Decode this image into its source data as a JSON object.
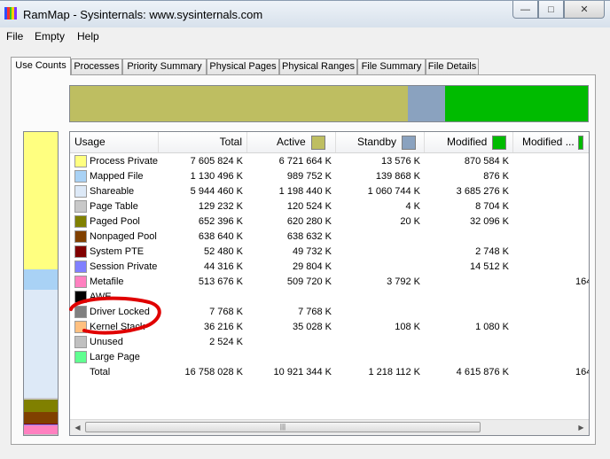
{
  "window": {
    "title": "RamMap - Sysinternals: www.sysinternals.com"
  },
  "caption": {
    "minimize": "—",
    "maximize": "□",
    "close": "✕"
  },
  "menu": [
    "File",
    "Empty",
    "Help"
  ],
  "tabs": [
    "Use Counts",
    "Processes",
    "Priority Summary",
    "Physical Pages",
    "Physical Ranges",
    "File Summary",
    "File Details"
  ],
  "active_tab": "Use Counts",
  "colors": {
    "active": "#bebe61",
    "standby": "#8aa2bf",
    "modified": "#00bb00",
    "modified_nowrite": "#00bb00",
    "process_private": "#ffff80",
    "mapped_file": "#a9d2f5",
    "shareable": "#dde9f7",
    "page_table": "#c8c8c8",
    "paged_pool": "#808000",
    "nonpaged_pool": "#804000",
    "system_pte": "#800000",
    "session_private": "#8080ff",
    "metafile": "#ff80c0",
    "awe": "#000000",
    "driver_locked": "#808080",
    "kernel_stack": "#ffc080",
    "unused": "#c0c0c0",
    "large_page": "#60ff90",
    "annotation": "#e00000"
  },
  "usage_bar": [
    {
      "name": "active",
      "fraction": 0.652
    },
    {
      "name": "standby",
      "fraction": 0.073
    },
    {
      "name": "modified",
      "fraction": 0.275
    }
  ],
  "sidebar_bar": [
    {
      "name": "process_private",
      "fraction": 0.454
    },
    {
      "name": "mapped_file",
      "fraction": 0.067
    },
    {
      "name": "shareable",
      "fraction": 0.355
    },
    {
      "name": "page_table",
      "fraction": 0.008
    },
    {
      "name": "paged_pool",
      "fraction": 0.039
    },
    {
      "name": "nonpaged_pool",
      "fraction": 0.038
    },
    {
      "name": "system_pte",
      "fraction": 0.003
    },
    {
      "name": "session_private",
      "fraction": 0.003
    },
    {
      "name": "metafile",
      "fraction": 0.031
    },
    {
      "name": "unused",
      "fraction": 0.002
    }
  ],
  "columns": [
    "Usage",
    "Total",
    "Active",
    "Standby",
    "Modified",
    "Modified ..."
  ],
  "rows": [
    {
      "name": "Process Private",
      "color": "process_private",
      "total": "7 605 824 K",
      "active": "6 721 664 K",
      "standby": "13 576 K",
      "modified": "870 584 K",
      "modified_nw": ""
    },
    {
      "name": "Mapped File",
      "color": "mapped_file",
      "total": "1 130 496 K",
      "active": "989 752 K",
      "standby": "139 868 K",
      "modified": "876 K",
      "modified_nw": ""
    },
    {
      "name": "Shareable",
      "color": "shareable",
      "total": "5 944 460 K",
      "active": "1 198 440 K",
      "standby": "1 060 744 K",
      "modified": "3 685 276 K",
      "modified_nw": ""
    },
    {
      "name": "Page Table",
      "color": "page_table",
      "total": "129 232 K",
      "active": "120 524 K",
      "standby": "4 K",
      "modified": "8 704 K",
      "modified_nw": ""
    },
    {
      "name": "Paged Pool",
      "color": "paged_pool",
      "total": "652 396 K",
      "active": "620 280 K",
      "standby": "20 K",
      "modified": "32 096 K",
      "modified_nw": ""
    },
    {
      "name": "Nonpaged Pool",
      "color": "nonpaged_pool",
      "total": "638 640 K",
      "active": "638 632 K",
      "standby": "",
      "modified": "",
      "modified_nw": ""
    },
    {
      "name": "System PTE",
      "color": "system_pte",
      "total": "52 480 K",
      "active": "49 732 K",
      "standby": "",
      "modified": "2 748 K",
      "modified_nw": ""
    },
    {
      "name": "Session Private",
      "color": "session_private",
      "total": "44 316 K",
      "active": "29 804 K",
      "standby": "",
      "modified": "14 512 K",
      "modified_nw": ""
    },
    {
      "name": "Metafile",
      "color": "metafile",
      "total": "513 676 K",
      "active": "509 720 K",
      "standby": "3 792 K",
      "modified": "",
      "modified_nw": "164"
    },
    {
      "name": "AWE",
      "color": "awe",
      "total": "",
      "active": "",
      "standby": "",
      "modified": "",
      "modified_nw": ""
    },
    {
      "name": "Driver Locked",
      "color": "driver_locked",
      "total": "7 768 K",
      "active": "7 768 K",
      "standby": "",
      "modified": "",
      "modified_nw": ""
    },
    {
      "name": "Kernel Stack",
      "color": "kernel_stack",
      "total": "36 216 K",
      "active": "35 028 K",
      "standby": "108 K",
      "modified": "1 080 K",
      "modified_nw": ""
    },
    {
      "name": "Unused",
      "color": "unused",
      "total": "2 524 K",
      "active": "",
      "standby": "",
      "modified": "",
      "modified_nw": ""
    },
    {
      "name": "Large Page",
      "color": "large_page",
      "total": "",
      "active": "",
      "standby": "",
      "modified": "",
      "modified_nw": ""
    },
    {
      "name": "Total",
      "color": "",
      "total": "16 758 028 K",
      "active": "10 921 344 K",
      "standby": "1 218 112 K",
      "modified": "4 615 876 K",
      "modified_nw": "164"
    }
  ],
  "scrollbar": {
    "left_arrow": "◀",
    "right_arrow": "▶",
    "grip": "|||"
  }
}
